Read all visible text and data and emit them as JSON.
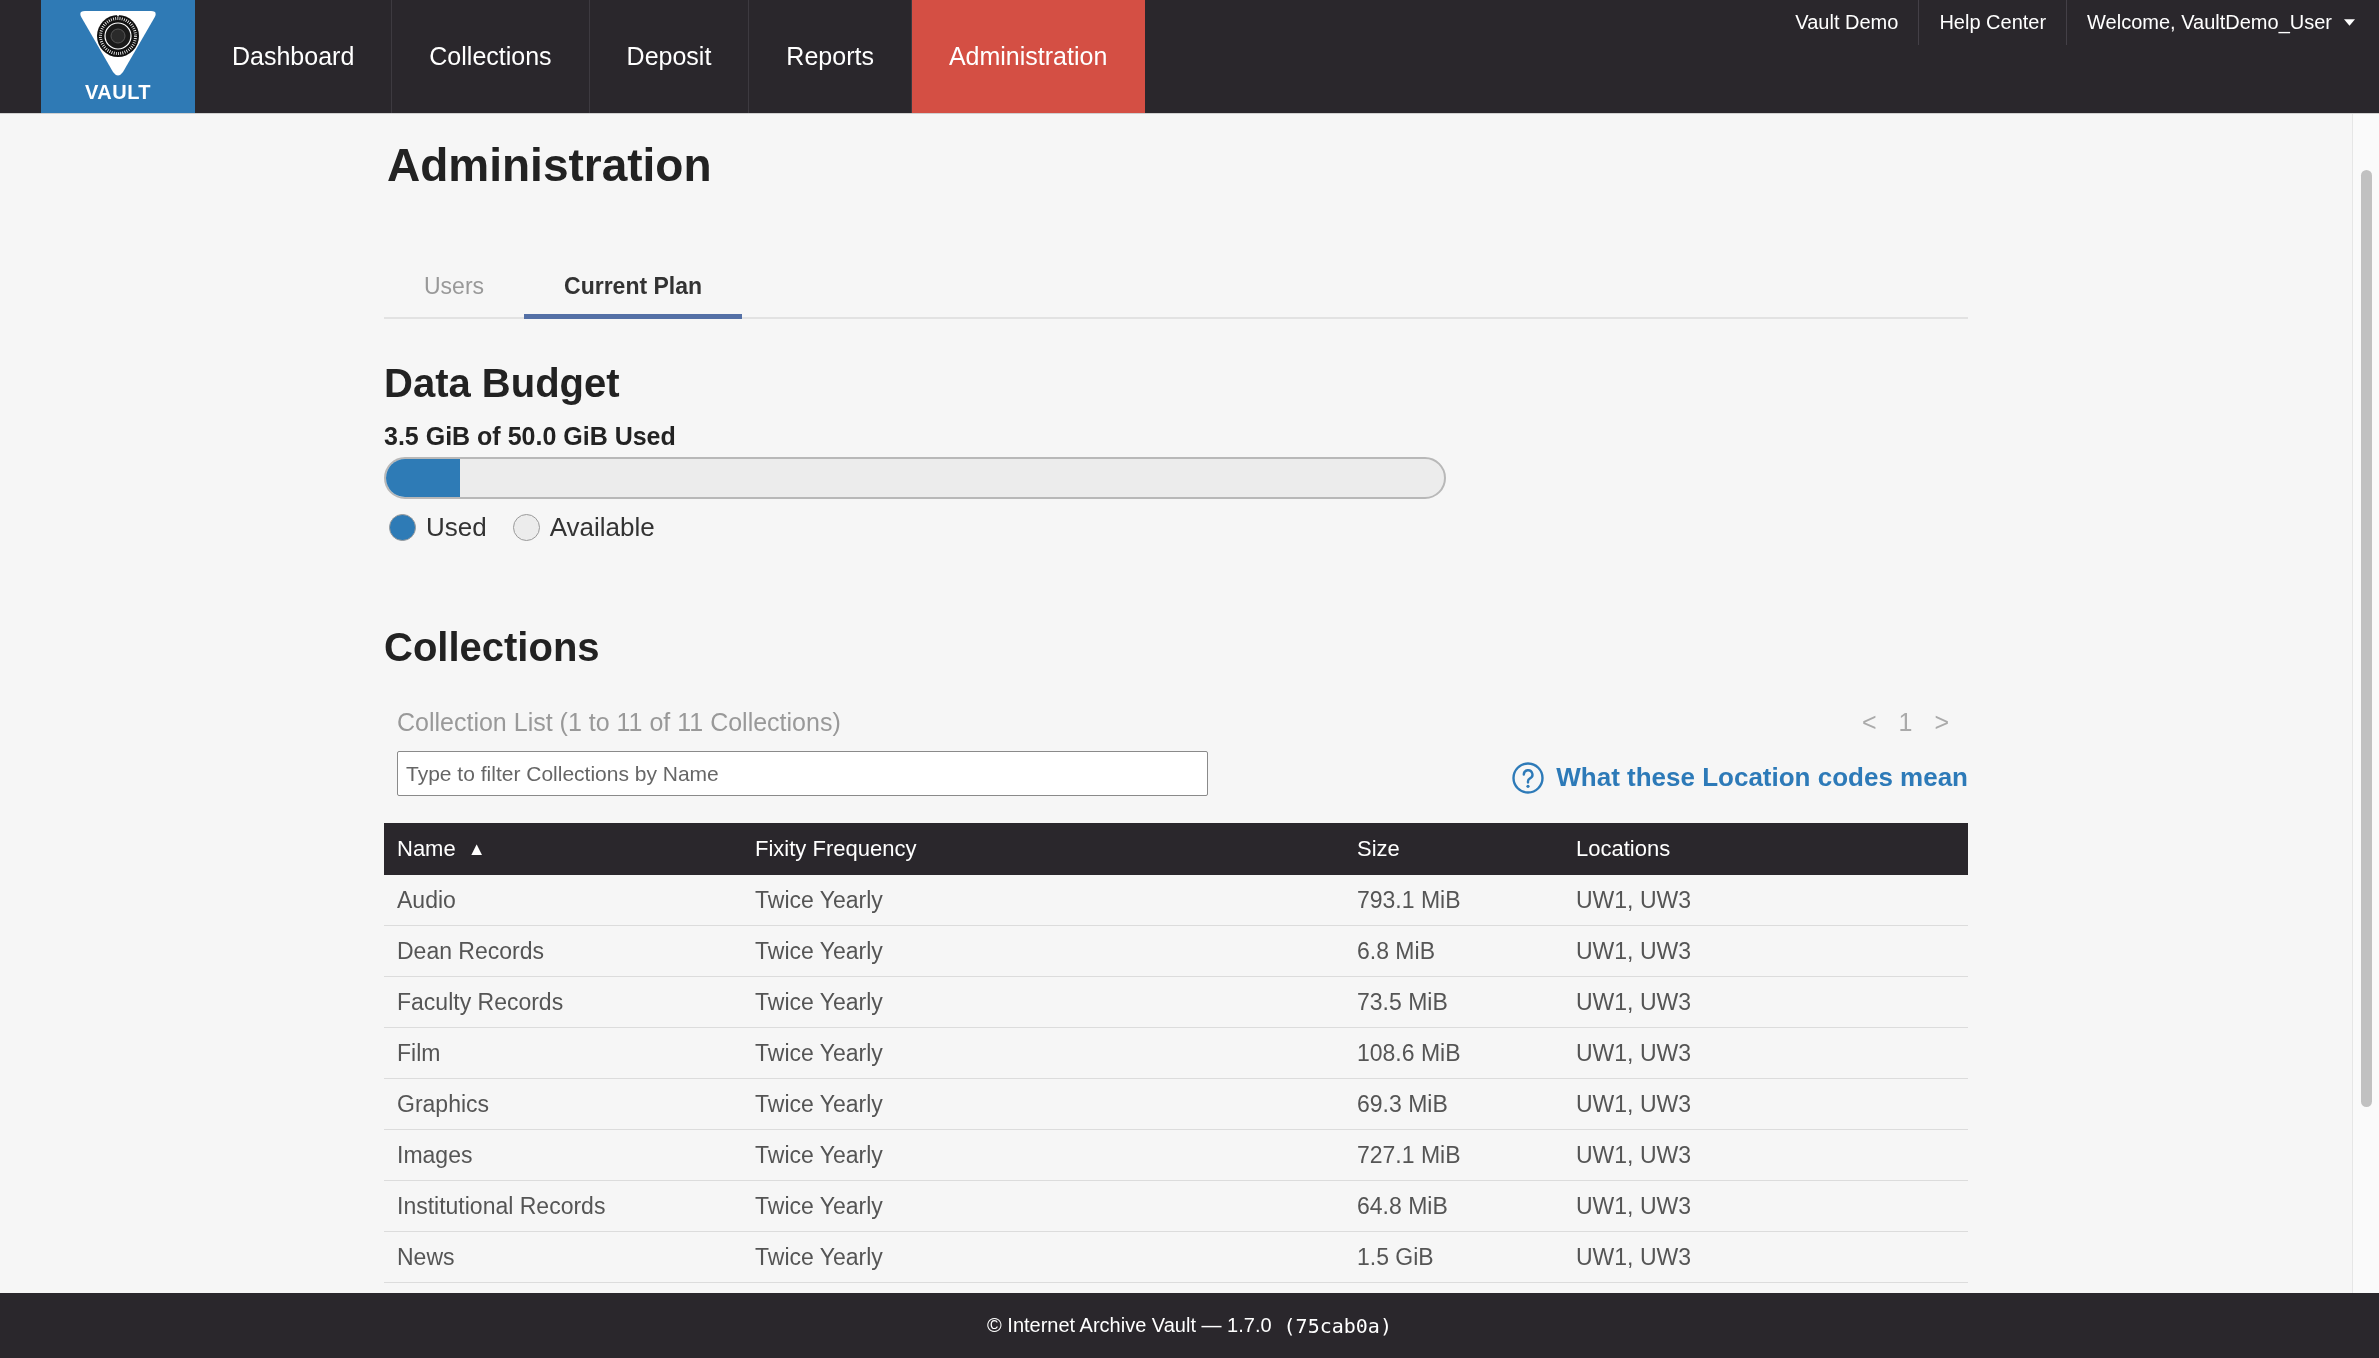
{
  "header": {
    "logo": {
      "text": "VAULT"
    },
    "nav": [
      {
        "label": "Dashboard",
        "selected": false
      },
      {
        "label": "Collections",
        "selected": false
      },
      {
        "label": "Deposit",
        "selected": false
      },
      {
        "label": "Reports",
        "selected": false
      },
      {
        "label": "Administration",
        "selected": true
      }
    ],
    "links": [
      "Vault Demo",
      "Help Center"
    ],
    "user_menu": {
      "label": "Welcome, VaultDemo_User"
    }
  },
  "page": {
    "title": "Administration"
  },
  "tabs": [
    {
      "label": "Users",
      "selected": false
    },
    {
      "label": "Current Plan",
      "selected": true
    }
  ],
  "data_budget": {
    "heading": "Data Budget",
    "usage": "3.5 GiB of 50.0 GiB Used",
    "level": 0.07,
    "legend": [
      {
        "label": "Used",
        "color": "#2e7bb6"
      },
      {
        "label": "Available",
        "color": "#ececec"
      }
    ]
  },
  "collections": {
    "heading": "Collections",
    "summary": "Collection List (1 to 11 of 11 Collections)",
    "pager": {
      "prev": "<",
      "current": "1",
      "next": ">"
    },
    "filter": {
      "placeholder": "Type to filter Collections by Name"
    },
    "help_link": "What these Location codes mean",
    "table": {
      "columns": [
        {
          "label": "Name",
          "sort_indicator": "▲"
        },
        {
          "label": "Fixity Frequency"
        },
        {
          "label": "Size"
        },
        {
          "label": "Locations"
        }
      ],
      "rows": [
        [
          "Audio",
          "Twice Yearly",
          "793.1 MiB",
          "UW1, UW3"
        ],
        [
          "Dean Records",
          "Twice Yearly",
          "6.8 MiB",
          "UW1, UW3"
        ],
        [
          "Faculty Records",
          "Twice Yearly",
          "73.5 MiB",
          "UW1, UW3"
        ],
        [
          "Film",
          "Twice Yearly",
          "108.6 MiB",
          "UW1, UW3"
        ],
        [
          "Graphics",
          "Twice Yearly",
          "69.3 MiB",
          "UW1, UW3"
        ],
        [
          "Images",
          "Twice Yearly",
          "727.1 MiB",
          "UW1, UW3"
        ],
        [
          "Institutional Records",
          "Twice Yearly",
          "64.8 MiB",
          "UW1, UW3"
        ],
        [
          "News",
          "Twice Yearly",
          "1.5 GiB",
          "UW1, UW3"
        ]
      ]
    }
  },
  "footer": {
    "text": "© Internet Archive Vault — 1.7.0",
    "build": "(75cab0a)"
  }
}
